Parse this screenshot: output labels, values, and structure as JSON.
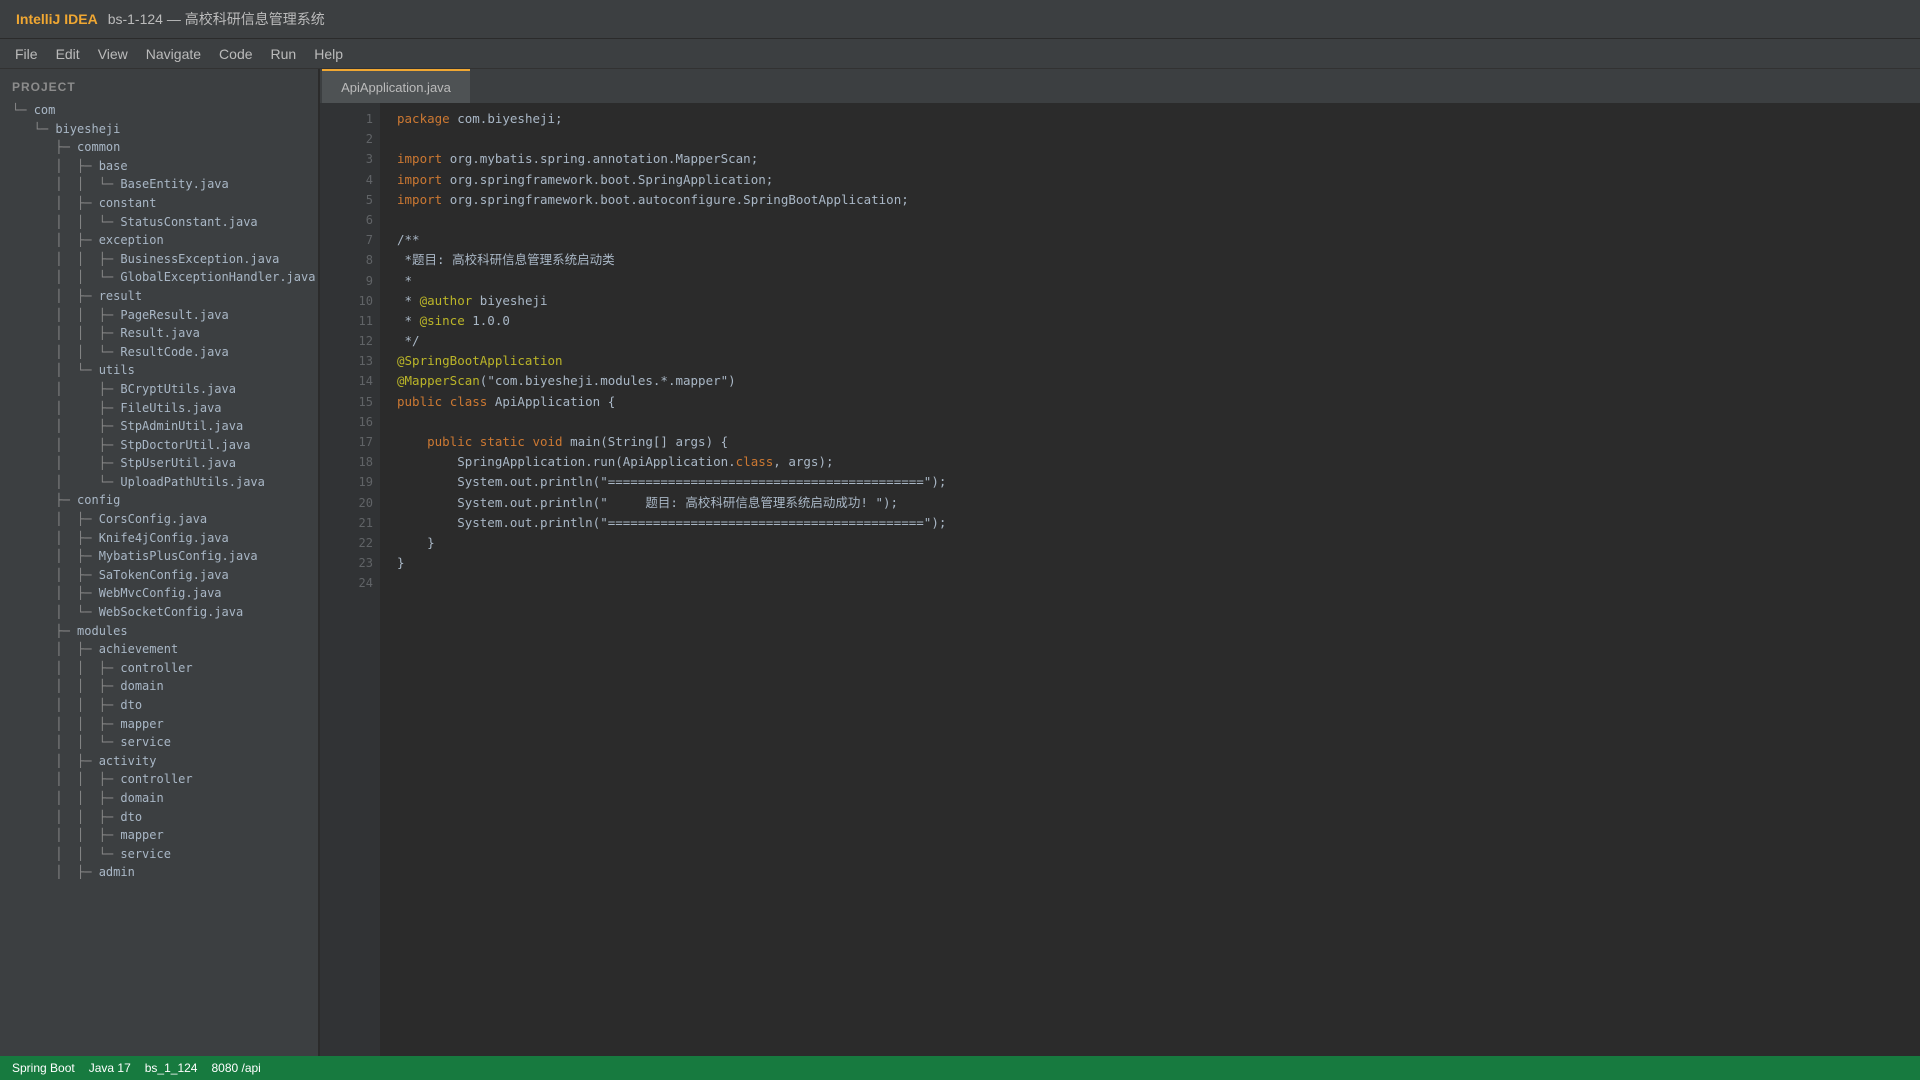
{
  "window": {
    "app_name": "IntelliJ IDEA",
    "title": "bs-1-124 — 高校科研信息管理系统"
  },
  "menu": [
    "File",
    "Edit",
    "View",
    "Navigate",
    "Code",
    "Run",
    "Help"
  ],
  "sidebar": {
    "header": "PROJECT",
    "tree": [
      {
        "guide": "└─ ",
        "label": "com"
      },
      {
        "guide": "   └─ ",
        "label": "biyesheji"
      },
      {
        "guide": "      ├─ ",
        "label": "common"
      },
      {
        "guide": "      │  ├─ ",
        "label": "base"
      },
      {
        "guide": "      │  │  └─ ",
        "label": "BaseEntity.java"
      },
      {
        "guide": "      │  ├─ ",
        "label": "constant"
      },
      {
        "guide": "      │  │  └─ ",
        "label": "StatusConstant.java"
      },
      {
        "guide": "      │  ├─ ",
        "label": "exception"
      },
      {
        "guide": "      │  │  ├─ ",
        "label": "BusinessException.java"
      },
      {
        "guide": "      │  │  └─ ",
        "label": "GlobalExceptionHandler.java"
      },
      {
        "guide": "      │  ├─ ",
        "label": "result"
      },
      {
        "guide": "      │  │  ├─ ",
        "label": "PageResult.java"
      },
      {
        "guide": "      │  │  ├─ ",
        "label": "Result.java"
      },
      {
        "guide": "      │  │  └─ ",
        "label": "ResultCode.java"
      },
      {
        "guide": "      │  └─ ",
        "label": "utils"
      },
      {
        "guide": "      │     ├─ ",
        "label": "BCryptUtils.java"
      },
      {
        "guide": "      │     ├─ ",
        "label": "FileUtils.java"
      },
      {
        "guide": "      │     ├─ ",
        "label": "StpAdminUtil.java"
      },
      {
        "guide": "      │     ├─ ",
        "label": "StpDoctorUtil.java"
      },
      {
        "guide": "      │     ├─ ",
        "label": "StpUserUtil.java"
      },
      {
        "guide": "      │     └─ ",
        "label": "UploadPathUtils.java"
      },
      {
        "guide": "      ├─ ",
        "label": "config"
      },
      {
        "guide": "      │  ├─ ",
        "label": "CorsConfig.java"
      },
      {
        "guide": "      │  ├─ ",
        "label": "Knife4jConfig.java"
      },
      {
        "guide": "      │  ├─ ",
        "label": "MybatisPlusConfig.java"
      },
      {
        "guide": "      │  ├─ ",
        "label": "SaTokenConfig.java"
      },
      {
        "guide": "      │  ├─ ",
        "label": "WebMvcConfig.java"
      },
      {
        "guide": "      │  └─ ",
        "label": "WebSocketConfig.java"
      },
      {
        "guide": "      ├─ ",
        "label": "modules"
      },
      {
        "guide": "      │  ├─ ",
        "label": "achievement"
      },
      {
        "guide": "      │  │  ├─ ",
        "label": "controller"
      },
      {
        "guide": "      │  │  ├─ ",
        "label": "domain"
      },
      {
        "guide": "      │  │  ├─ ",
        "label": "dto"
      },
      {
        "guide": "      │  │  ├─ ",
        "label": "mapper"
      },
      {
        "guide": "      │  │  └─ ",
        "label": "service"
      },
      {
        "guide": "      │  ├─ ",
        "label": "activity"
      },
      {
        "guide": "      │  │  ├─ ",
        "label": "controller"
      },
      {
        "guide": "      │  │  ├─ ",
        "label": "domain"
      },
      {
        "guide": "      │  │  ├─ ",
        "label": "dto"
      },
      {
        "guide": "      │  │  ├─ ",
        "label": "mapper"
      },
      {
        "guide": "      │  │  └─ ",
        "label": "service"
      },
      {
        "guide": "      │  ├─ ",
        "label": "admin"
      }
    ]
  },
  "editor": {
    "tab": "ApiApplication.java",
    "lines": [
      [
        {
          "t": "package ",
          "c": "kw"
        },
        {
          "t": "com.biyesheji;",
          "c": ""
        }
      ],
      [],
      [
        {
          "t": "import ",
          "c": "kw"
        },
        {
          "t": "org.mybatis.spring.annotation.MapperScan;",
          "c": ""
        }
      ],
      [
        {
          "t": "import ",
          "c": "kw"
        },
        {
          "t": "org.springframework.boot.SpringApplication;",
          "c": ""
        }
      ],
      [
        {
          "t": "import ",
          "c": "kw"
        },
        {
          "t": "org.springframework.boot.autoconfigure.SpringBootApplication;",
          "c": ""
        }
      ],
      [],
      [
        {
          "t": "/**",
          "c": "cmt"
        }
      ],
      [
        {
          "t": " *题目: 高校科研信息管理系统启动类",
          "c": "cmt"
        }
      ],
      [
        {
          "t": " *",
          "c": "cmt"
        }
      ],
      [
        {
          "t": " * ",
          "c": "cmt"
        },
        {
          "t": "@author",
          "c": "jd"
        },
        {
          "t": " biyesheji",
          "c": "cmt"
        }
      ],
      [
        {
          "t": " * ",
          "c": "cmt"
        },
        {
          "t": "@since",
          "c": "jd"
        },
        {
          "t": " 1.0.0",
          "c": "cmt"
        }
      ],
      [
        {
          "t": " */",
          "c": "cmt"
        }
      ],
      [
        {
          "t": "@SpringBootApplication",
          "c": "ann"
        }
      ],
      [
        {
          "t": "@MapperScan",
          "c": "ann"
        },
        {
          "t": "(\"com.biyesheji.modules.*.mapper\")",
          "c": ""
        }
      ],
      [
        {
          "t": "public ",
          "c": "kw"
        },
        {
          "t": "class ",
          "c": "kw"
        },
        {
          "t": "ApiApplication {",
          "c": ""
        }
      ],
      [],
      [
        {
          "t": "    public ",
          "c": "kw"
        },
        {
          "t": "static ",
          "c": "kw"
        },
        {
          "t": "void ",
          "c": "kw"
        },
        {
          "t": "main(String[] args) {",
          "c": ""
        }
      ],
      [
        {
          "t": "        SpringApplication.run(ApiApplication.",
          "c": ""
        },
        {
          "t": "class",
          "c": "kw"
        },
        {
          "t": ", args);",
          "c": ""
        }
      ],
      [
        {
          "t": "        System.out.println(\"==========================================\");",
          "c": ""
        }
      ],
      [
        {
          "t": "        System.out.println(\"     题目: 高校科研信息管理系统启动成功! \");",
          "c": ""
        }
      ],
      [
        {
          "t": "        System.out.println(\"==========================================\");",
          "c": ""
        }
      ],
      [
        {
          "t": "    }",
          "c": ""
        }
      ],
      [
        {
          "t": "}",
          "c": ""
        }
      ],
      []
    ]
  },
  "statusbar": [
    "Spring Boot",
    "Java 17",
    "bs_1_124",
    "8080 /api"
  ],
  "colors": {
    "accent": "#f0a732",
    "keyword": "#cc7832",
    "annotation": "#bbb529",
    "statusbar": "#177a3f"
  }
}
